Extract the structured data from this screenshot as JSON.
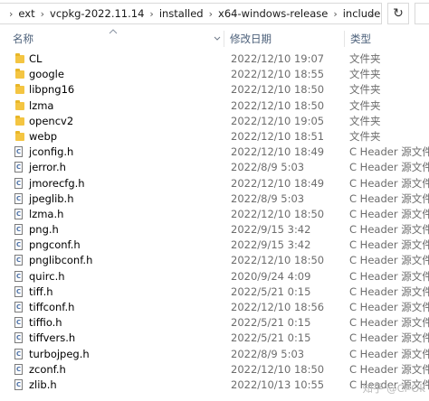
{
  "address_bar": {
    "crumbs": [
      "ext",
      "vcpkg-2022.11.14",
      "installed",
      "x64-windows-release",
      "include"
    ],
    "dropdown_glyph": "⌄",
    "refresh_glyph": "↻"
  },
  "columns": {
    "name": "名称",
    "date": "修改日期",
    "type": "类型"
  },
  "rows": [
    {
      "kind": "folder",
      "name": "CL",
      "date": "2022/12/10 19:07",
      "type": "文件夹"
    },
    {
      "kind": "folder",
      "name": "google",
      "date": "2022/12/10 18:55",
      "type": "文件夹"
    },
    {
      "kind": "folder",
      "name": "libpng16",
      "date": "2022/12/10 18:50",
      "type": "文件夹"
    },
    {
      "kind": "folder",
      "name": "lzma",
      "date": "2022/12/10 18:50",
      "type": "文件夹"
    },
    {
      "kind": "folder",
      "name": "opencv2",
      "date": "2022/12/10 19:05",
      "type": "文件夹"
    },
    {
      "kind": "folder",
      "name": "webp",
      "date": "2022/12/10 18:51",
      "type": "文件夹"
    },
    {
      "kind": "file",
      "name": "jconfig.h",
      "date": "2022/12/10 18:49",
      "type": "C Header 源文件"
    },
    {
      "kind": "file",
      "name": "jerror.h",
      "date": "2022/8/9 5:03",
      "type": "C Header 源文件"
    },
    {
      "kind": "file",
      "name": "jmorecfg.h",
      "date": "2022/12/10 18:49",
      "type": "C Header 源文件"
    },
    {
      "kind": "file",
      "name": "jpeglib.h",
      "date": "2022/8/9 5:03",
      "type": "C Header 源文件"
    },
    {
      "kind": "file",
      "name": "lzma.h",
      "date": "2022/12/10 18:50",
      "type": "C Header 源文件"
    },
    {
      "kind": "file",
      "name": "png.h",
      "date": "2022/9/15 3:42",
      "type": "C Header 源文件"
    },
    {
      "kind": "file",
      "name": "pngconf.h",
      "date": "2022/9/15 3:42",
      "type": "C Header 源文件"
    },
    {
      "kind": "file",
      "name": "pnglibconf.h",
      "date": "2022/12/10 18:50",
      "type": "C Header 源文件"
    },
    {
      "kind": "file",
      "name": "quirc.h",
      "date": "2020/9/24 4:09",
      "type": "C Header 源文件"
    },
    {
      "kind": "file",
      "name": "tiff.h",
      "date": "2022/5/21 0:15",
      "type": "C Header 源文件"
    },
    {
      "kind": "file",
      "name": "tiffconf.h",
      "date": "2022/12/10 18:56",
      "type": "C Header 源文件"
    },
    {
      "kind": "file",
      "name": "tiffio.h",
      "date": "2022/5/21 0:15",
      "type": "C Header 源文件"
    },
    {
      "kind": "file",
      "name": "tiffvers.h",
      "date": "2022/5/21 0:15",
      "type": "C Header 源文件"
    },
    {
      "kind": "file",
      "name": "turbojpeg.h",
      "date": "2022/8/9 5:03",
      "type": "C Header 源文件"
    },
    {
      "kind": "file",
      "name": "zconf.h",
      "date": "2022/12/10 18:50",
      "type": "C Header 源文件"
    },
    {
      "kind": "file",
      "name": "zlib.h",
      "date": "2022/10/13 10:55",
      "type": "C Header 源文件"
    }
  ],
  "watermark": "知乎 @Cl-Ok"
}
